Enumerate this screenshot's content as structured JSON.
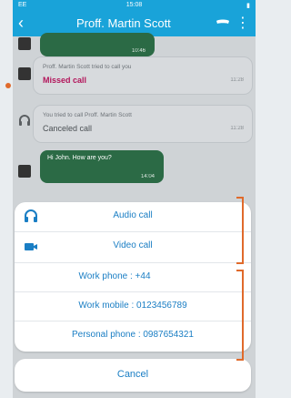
{
  "status": {
    "left": "EE",
    "time": "15:08"
  },
  "header": {
    "title": "Proff. Martin Scott"
  },
  "messages": [
    {
      "time": "10:46"
    },
    {
      "line1": "Proff. Martin Scott tried to call you",
      "line2": "Missed call",
      "time": "11:28"
    },
    {
      "line1": "You tried to call Proff. Martin Scott",
      "line2": "Canceled call",
      "time": "11:28"
    },
    {
      "text": "Hi John. How are you?",
      "time": "14:04"
    }
  ],
  "sheet": {
    "audio": "Audio call",
    "video": "Video call",
    "work_phone": "Work phone : +44",
    "work_mobile": "Work mobile : 0123456789",
    "personal_phone": "Personal phone : 0987654321"
  },
  "cancel": "Cancel",
  "colors": {
    "accent": "#19a3d9",
    "action_text": "#1a7ec4",
    "missed": "#b3155b",
    "bubble": "#2b6a45",
    "bracket": "#e06a2b"
  }
}
